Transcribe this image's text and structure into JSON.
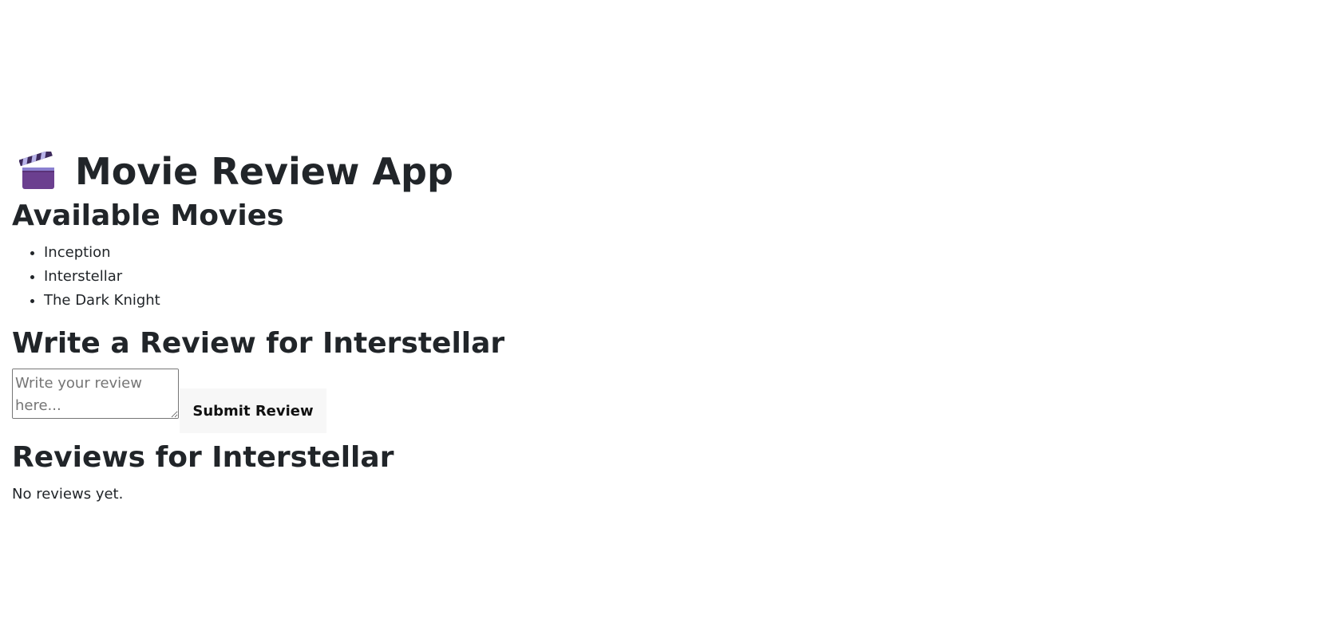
{
  "header": {
    "title": "Movie Review App",
    "icon": "clapperboard-icon"
  },
  "movies": {
    "heading": "Available Movies",
    "items": [
      "Inception",
      "Interstellar",
      "The Dark Knight"
    ]
  },
  "write_review": {
    "heading": "Write a Review for Interstellar",
    "placeholder": "Write your review here...",
    "value": "",
    "submit_label": "Submit Review"
  },
  "reviews": {
    "heading": "Reviews for Interstellar",
    "empty_text": "No reviews yet."
  },
  "colors": {
    "text": "#212529",
    "button_bg": "#f7f7f7",
    "clapper_body": "#6b3f8f",
    "clapper_stripe": "#9b8fd6"
  }
}
